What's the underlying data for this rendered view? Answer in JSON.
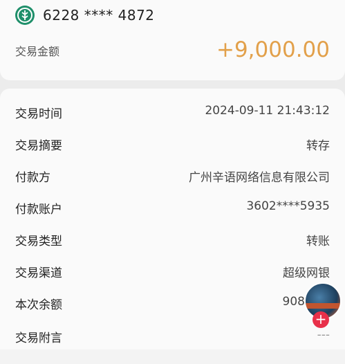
{
  "account": {
    "number": "6228 **** 4872",
    "logo_icon": "bank-logo-icon",
    "logo_color": "#1f8f6a"
  },
  "amount": {
    "label": "交易金额",
    "value": "+9,000.00",
    "color": "#e2a04a"
  },
  "details": [
    {
      "key": "交易时间",
      "value": "2024-09-11 21:43:12"
    },
    {
      "key": "交易摘要",
      "value": "转存"
    },
    {
      "key": "付款方",
      "value": "广州辛语网络信息有限公司"
    },
    {
      "key": "付款账户",
      "value": "3602****5935"
    },
    {
      "key": "交易类型",
      "value": "转账"
    },
    {
      "key": "交易渠道",
      "value": "超级网银"
    },
    {
      "key": "本次余额",
      "value": "908"
    },
    {
      "key": "交易附言",
      "value": "---"
    }
  ],
  "overlay": {
    "plus_label": "+",
    "plus_color": "#e8304a"
  }
}
